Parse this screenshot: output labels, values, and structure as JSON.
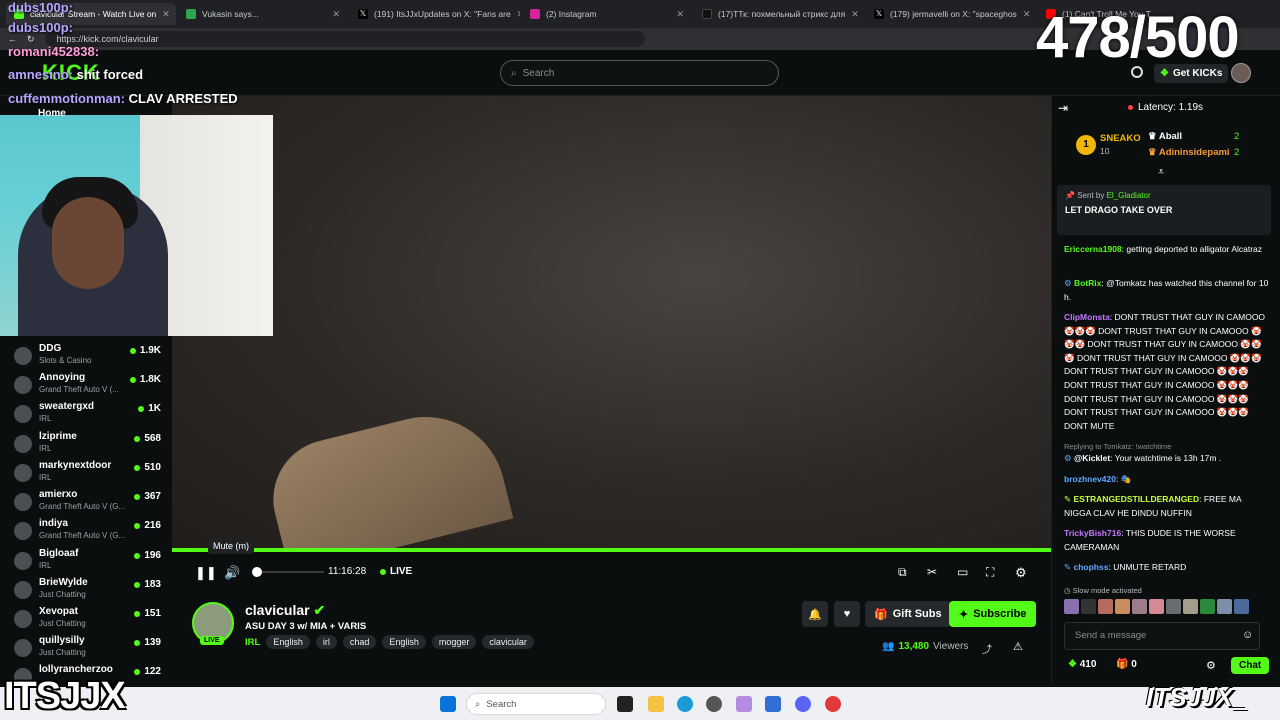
{
  "browser": {
    "tabs": [
      {
        "label": "clavicular Stream - Watch Live on",
        "color": "#53fc18"
      },
      {
        "label": "Vukasin says...",
        "color": "#2ea44f"
      },
      {
        "label": "(191) ItsJJxUpdates on X: \"Fans are",
        "color": "#000000"
      },
      {
        "label": "(2) Instagram",
        "color": "#d6249f"
      },
      {
        "label": "(17)ТТк: похмельный стрикс для",
        "color": "#111111"
      },
      {
        "label": "(179) jermavelli on X: \"spaceghos",
        "color": "#000000"
      },
      {
        "label": "(1) Can't Troll Me You T",
        "color": "#ff0000"
      }
    ],
    "url": "https://kick.com/clavicular"
  },
  "header": {
    "logo": "KICK",
    "search_placeholder": "Search",
    "get_kicks": "Get KICKs"
  },
  "overlay": {
    "counter": "478/500",
    "chat_lines": [
      {
        "user": "dubs100p:",
        "msg": ""
      },
      {
        "user": "dubs100p:",
        "msg": ""
      },
      {
        "user": "romani452838:",
        "msg": ""
      },
      {
        "user": "amnesino:",
        "msg": "shit forced"
      },
      {
        "user": "cuffemmotionman:",
        "msg": "CLAV ARRESTED"
      }
    ],
    "home": "Home",
    "brand_left": "ITSJJX",
    "brand_right": "ITSJJX_"
  },
  "sidebar": {
    "channels": [
      {
        "name": "DDG",
        "category": "Slots & Casino",
        "viewers": "1.9K"
      },
      {
        "name": "Annoying",
        "category": "Grand Theft Auto V (...",
        "viewers": "1.8K"
      },
      {
        "name": "sweatergxd",
        "category": "IRL",
        "viewers": "1K"
      },
      {
        "name": "lziprime",
        "category": "IRL",
        "viewers": "568"
      },
      {
        "name": "markynextdoor",
        "category": "IRL",
        "viewers": "510"
      },
      {
        "name": "amierxo",
        "category": "Grand Theft Auto V (G...",
        "viewers": "367"
      },
      {
        "name": "indiya",
        "category": "Grand Theft Auto V (G...",
        "viewers": "216"
      },
      {
        "name": "Bigloaaf",
        "category": "IRL",
        "viewers": "196"
      },
      {
        "name": "BrieWylde",
        "category": "Just Chatting",
        "viewers": "183"
      },
      {
        "name": "Xevopat",
        "category": "Just Chatting",
        "viewers": "151"
      },
      {
        "name": "quillysilly",
        "category": "Just Chatting",
        "viewers": "139"
      },
      {
        "name": "lollyrancherzoo",
        "category": "",
        "viewers": "122"
      }
    ]
  },
  "player": {
    "tooltip": "Mute (m)",
    "time": "11:16:28",
    "live": "LIVE",
    "volume": 0.07
  },
  "stream": {
    "name": "clavicular",
    "title": "ASU DAY 3 w/ MIA + VARIS",
    "live_badge": "LIVE",
    "category": "IRL",
    "tags": [
      "English",
      "irl",
      "chad",
      "English",
      "mogger",
      "clavicular"
    ],
    "viewers_count": "13,480",
    "viewers_label": "Viewers",
    "gift_subs": "Gift Subs",
    "subscribe": "Subscribe"
  },
  "chat": {
    "latency": "Latency: 1.19s",
    "leaderboard": {
      "first_name": "SNEAKO",
      "first_rank": "1",
      "first_count": "10",
      "second": [
        {
          "name": "Aball",
          "count": "2"
        },
        {
          "name": "Adininsidepami",
          "count": "2"
        }
      ]
    },
    "pinned": {
      "sent_by_label": "Sent by",
      "sent_by": "El_Gladiator",
      "message": "LET DRAGO TAKE OVER"
    },
    "messages": [
      {
        "user": "Ericcerna1908",
        "color": "#53fc18",
        "text": "getting deported to alligator Alcatraz"
      },
      {
        "user": "BotRix",
        "color": "#53fc18",
        "text": "@Tomkatz has watched this channel for 10 h."
      },
      {
        "user": "ClipMonsta",
        "color": "#c478ff",
        "text": "DONT TRUST THAT GUY IN CAMOOO 🤡🤡🤡 DONT TRUST THAT GUY IN CAMOOO 🤡🤡🤡 DONT TRUST THAT GUY IN CAMOOO 🤡🤡🤡 DONT TRUST THAT GUY IN CAMOOO 🤡🤡🤡 DONT TRUST THAT GUY IN CAMOOO 🤡🤡🤡 DONT TRUST THAT GUY IN CAMOOO 🤡🤡🤡 DONT TRUST THAT GUY IN CAMOOO 🤡🤡🤡 DONT TRUST THAT GUY IN CAMOOO 🤡🤡🤡DONT MUTE"
      },
      {
        "reply": "Replying to Tomkatz: !watchtime"
      },
      {
        "user": "@Kicklet",
        "color": "#ffffff",
        "text": "Your watchtime is 13h 17m ."
      },
      {
        "user": "brozhnev420",
        "color": "#5fa8ff",
        "text": ""
      },
      {
        "user": "ESTRANGEDSTILLDERANGED",
        "color": "#c6ff3d",
        "text": "FREE MA NIGGA CLAV HE DINDU NUFFIN"
      },
      {
        "user": "TrickyBish716",
        "color": "#c478ff",
        "text": "THIS DUDE IS THE WORSE CAMERAMAN"
      },
      {
        "user": "chophss",
        "color": "#5fa8ff",
        "text": "UNMUTE RETARD"
      }
    ],
    "slow_mode": "Slow mode activated",
    "input_placeholder": "Send a message",
    "kicks_count": "410",
    "gifts_count": "0",
    "chat_button": "Chat"
  },
  "taskbar": {
    "search": "Search"
  }
}
